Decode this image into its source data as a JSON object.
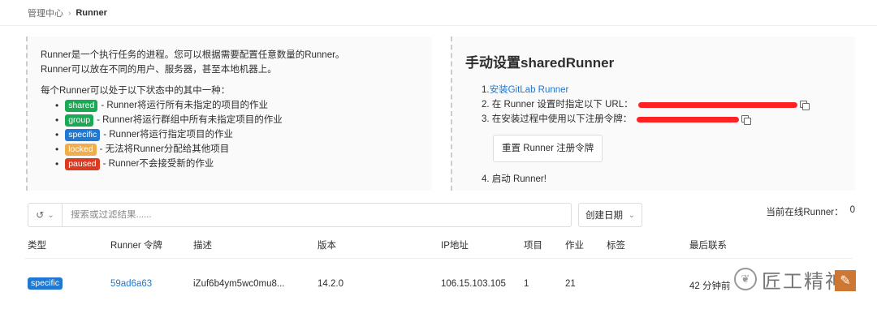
{
  "breadcrumb": {
    "parent": "管理中心",
    "current": "Runner"
  },
  "intro": {
    "line1": "Runner是一个执行任务的进程。您可以根据需要配置任意数量的Runner。",
    "line2": "Runner可以放在不同的用户、服务器，甚至本地机器上。",
    "states_intro": "每个Runner可以处于以下状态中的其中一种：",
    "states": [
      {
        "badge": "shared",
        "desc": "- Runner将运行所有未指定的项目的作业",
        "color": "#1aaa55"
      },
      {
        "badge": "group",
        "desc": "- Runner将运行群组中所有未指定项目的作业",
        "color": "#1aaa55"
      },
      {
        "badge": "specific",
        "desc": "- Runner将运行指定项目的作业",
        "color": "#1f78d1"
      },
      {
        "badge": "locked",
        "desc": "- 无法将Runner分配给其他项目",
        "color": "#f0ad4e"
      },
      {
        "badge": "paused",
        "desc": "- Runner不会接受新的作业",
        "color": "#db3b21"
      }
    ]
  },
  "setup": {
    "title": "手动设置sharedRunner",
    "step1_prefix": "1. ",
    "step1_link": "安装GitLab Runner",
    "step2": "2. 在 Runner 设置时指定以下 URL：",
    "step3": "3. 在安装过程中使用以下注册令牌：",
    "reset_button": "重置 Runner 注册令牌",
    "step4": "4. 启动 Runner!"
  },
  "filter": {
    "history_icon": "history-icon",
    "placeholder": "搜索或过滤结果......",
    "sort_label": "创建日期"
  },
  "online": {
    "label": "当前在线Runner：",
    "count": "0"
  },
  "table": {
    "headers": {
      "type": "类型",
      "token": "Runner 令牌",
      "description": "描述",
      "version": "版本",
      "ip": "IP地址",
      "projects": "项目",
      "jobs": "作业",
      "tags": "标签",
      "last_contact": "最后联系"
    },
    "rows": [
      {
        "type": "specific",
        "token": "59ad6a63",
        "description": "iZuf6b4ym5wc0mu8...",
        "version": "14.2.0",
        "ip": "106.15.103.105",
        "projects": "1",
        "jobs": "21",
        "tags": "",
        "last_contact": "42 分钟前"
      }
    ]
  },
  "watermark": {
    "text": "匠工精神"
  }
}
